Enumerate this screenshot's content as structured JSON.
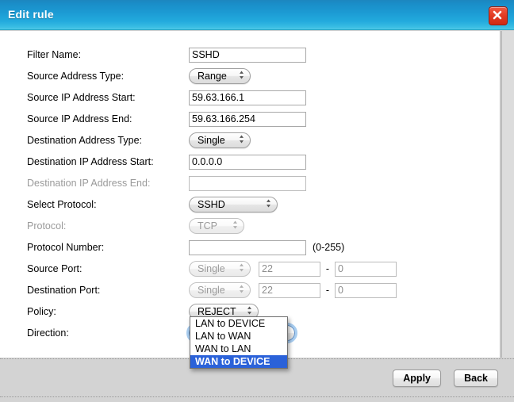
{
  "window": {
    "title": "Edit rule",
    "close_icon": "close-icon",
    "accent_color": "#1c9ad3",
    "close_color": "#e23b22"
  },
  "form": {
    "fields": [
      {
        "label": "Filter Name:",
        "value": "SSHD"
      },
      {
        "label": "Source Address Type:",
        "value": "Range"
      },
      {
        "label": "Source IP Address Start:",
        "value": "59.63.166.1"
      },
      {
        "label": "Source IP Address End:",
        "value": "59.63.166.254"
      },
      {
        "label": "Destination Address Type:",
        "value": "Single"
      },
      {
        "label": "Destination IP Address Start:",
        "value": "0.0.0.0"
      },
      {
        "label": "Destination IP Address End:",
        "value": ""
      },
      {
        "label": "Select Protocol:",
        "value": "SSHD"
      },
      {
        "label": "Protocol:",
        "value": "TCP"
      },
      {
        "label": "Protocol Number:",
        "value": "",
        "hint": "(0-255)"
      },
      {
        "label": "Source Port:",
        "value": "Single",
        "port_start": "22",
        "port_end": "0",
        "separator": "-"
      },
      {
        "label": "Destination Port:",
        "value": "Single",
        "port_start": "22",
        "port_end": "0",
        "separator": "-"
      },
      {
        "label": "Policy:",
        "value": "REJECT"
      },
      {
        "label": "Direction:",
        "value": "WAN to DEVICE"
      }
    ]
  },
  "direction_dropdown": {
    "open": true,
    "selected": "WAN to DEVICE",
    "highlight_color": "#2b62d9",
    "options": [
      "LAN to DEVICE",
      "LAN to WAN",
      "WAN to LAN",
      "WAN to DEVICE"
    ]
  },
  "footer": {
    "apply_label": "Apply",
    "back_label": "Back"
  }
}
